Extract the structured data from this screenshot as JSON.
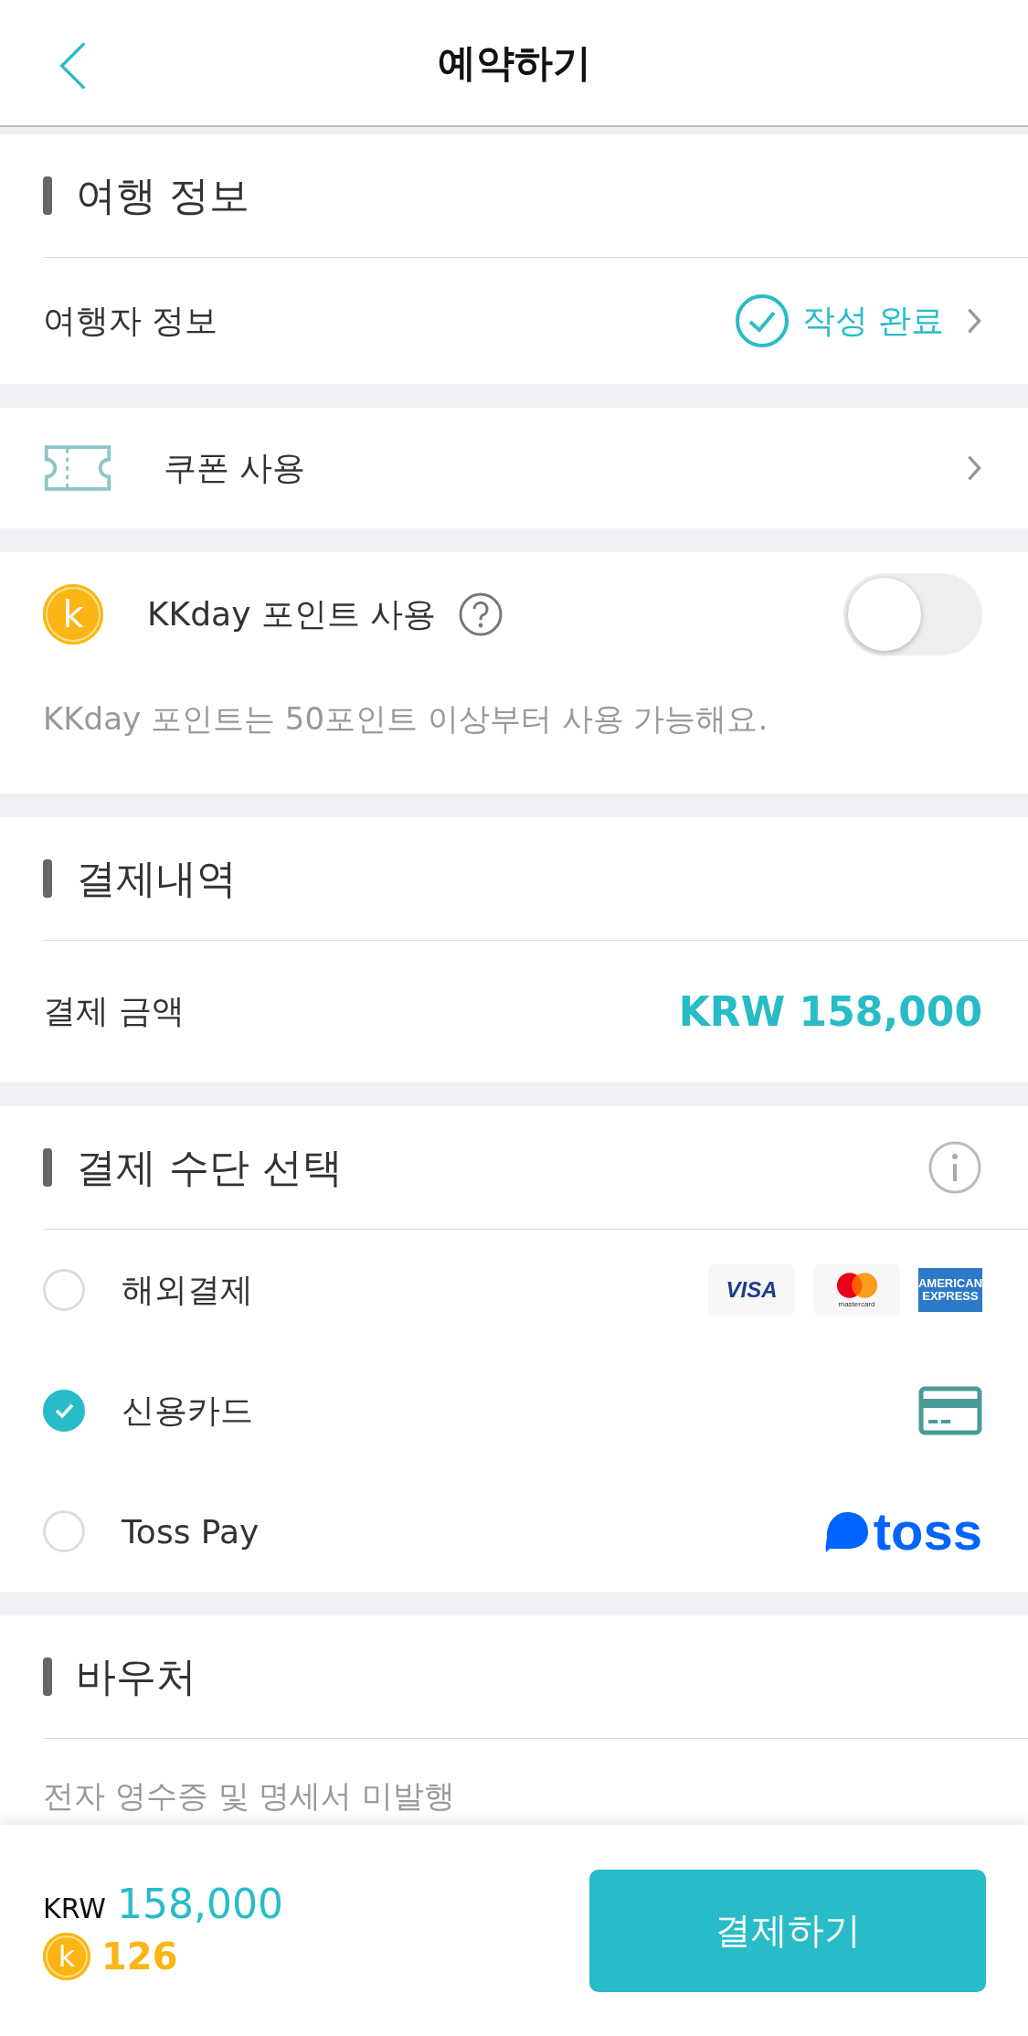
{
  "header": {
    "title": "예약하기"
  },
  "travel_info": {
    "title": "여행 정보",
    "row": {
      "label": "여행자 정보",
      "status": "작성 완료",
      "completed": true
    }
  },
  "coupon": {
    "label": "쿠폰 사용"
  },
  "points": {
    "label": "KKday 포인트 사용",
    "coin_letter": "k",
    "on": false,
    "note": "KKday 포인트는 50포인트 이상부터 사용 가능해요."
  },
  "payment_details": {
    "title": "결제내역",
    "label": "결제 금액",
    "amount": "KRW 158,000"
  },
  "payment_method": {
    "title": "결제 수단 선택",
    "options": [
      {
        "label": "해외결제",
        "selected": false,
        "kind": "cards",
        "logos": [
          {
            "kind": "visa",
            "text": "VISA"
          },
          {
            "kind": "mastercard",
            "text": "mastercard"
          },
          {
            "kind": "amex",
            "text": "AMERICAN EXPRESS"
          }
        ]
      },
      {
        "label": "신용카드",
        "selected": true,
        "kind": "card"
      },
      {
        "label": "Toss Pay",
        "selected": false,
        "kind": "toss",
        "logo_text": "toss"
      }
    ]
  },
  "voucher": {
    "title": "바우처",
    "note": "전자 영수증 및 명세서 미발행"
  },
  "footer": {
    "currency": "KRW",
    "total": "158,000",
    "coin_letter": "k",
    "points": "126",
    "button": "결제하기"
  }
}
